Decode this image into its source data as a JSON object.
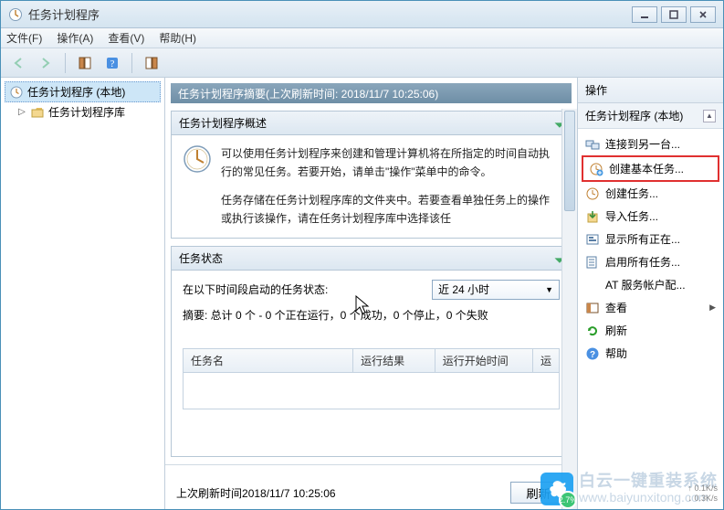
{
  "title": "任务计划程序",
  "menu": {
    "file": "文件(F)",
    "action": "操作(A)",
    "view": "查看(V)",
    "help": "帮助(H)"
  },
  "tree": {
    "root": "任务计划程序 (本地)",
    "child": "任务计划程序库"
  },
  "center": {
    "summary_header": "任务计划程序摘要(上次刷新时间: 2018/11/7 10:25:06)",
    "overview": {
      "title": "任务计划程序概述",
      "p1": "可以使用任务计划程序来创建和管理计算机将在所指定的时间自动执行的常见任务。若要开始，请单击\"操作\"菜单中的命令。",
      "p2": "任务存储在任务计划程序库的文件夹中。若要查看单独任务上的操作或执行该操作，请在任务计划程序库中选择该任"
    },
    "status": {
      "title": "任务状态",
      "label": "在以下时间段启动的任务状态:",
      "dropdown": "近 24 小时",
      "summary": "摘要: 总计 0 个 - 0 个正在运行，0 个成功，0 个停止，0 个失败"
    },
    "table": {
      "col1": "任务名",
      "col2": "运行结果",
      "col3": "运行开始时间",
      "col4": "运"
    },
    "last_refresh_label": "上次刷新时间",
    "last_refresh_value": "2018/11/7 10:25:06",
    "refresh_btn": "刷新"
  },
  "actions": {
    "header": "操作",
    "subheader": "任务计划程序 (本地)",
    "items": [
      {
        "icon": "connect",
        "label": "连接到另一台..."
      },
      {
        "icon": "create-basic",
        "label": "创建基本任务...",
        "highlight": true
      },
      {
        "icon": "create",
        "label": "创建任务..."
      },
      {
        "icon": "import",
        "label": "导入任务..."
      },
      {
        "icon": "show-running",
        "label": "显示所有正在..."
      },
      {
        "icon": "enable-history",
        "label": "启用所有任务..."
      },
      {
        "icon": "at-account",
        "label": "AT 服务帐户配..."
      },
      {
        "icon": "view",
        "label": "查看",
        "submenu": true
      },
      {
        "icon": "refresh",
        "label": "刷新"
      },
      {
        "icon": "help",
        "label": "帮助"
      }
    ]
  },
  "watermark": {
    "line1": "白云一键重装系统",
    "line2": "www.baiyunxitong.com",
    "badge": "2.7%"
  },
  "net": {
    "up": "0.1K/s",
    "down": "0.3K/s"
  }
}
